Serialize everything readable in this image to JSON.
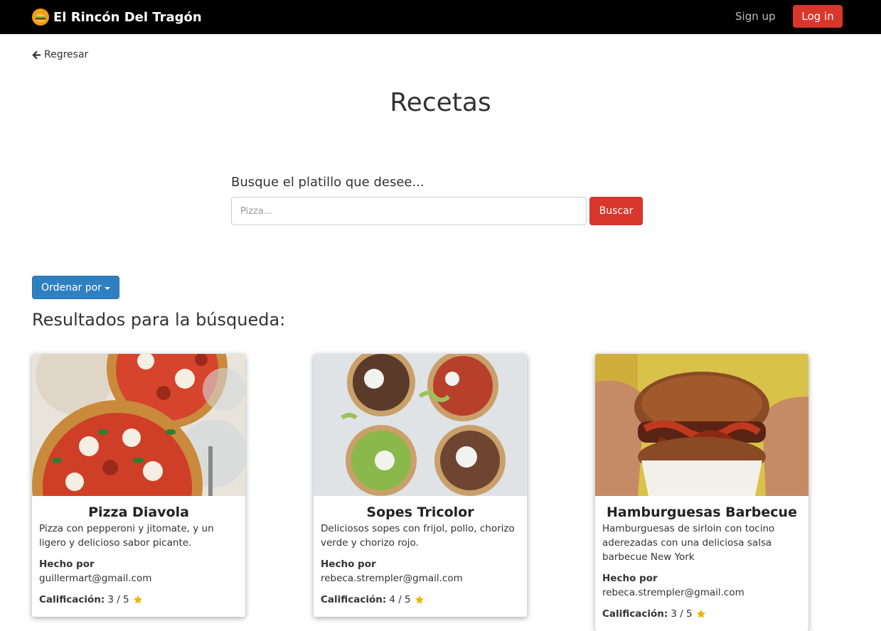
{
  "navbar": {
    "brand": "El Rincón Del Tragón",
    "signup": "Sign up",
    "login": "Log in"
  },
  "back_label": "Regresar",
  "page_title": "Recetas",
  "search": {
    "label": "Busque el platillo que desee...",
    "placeholder": "Pizza...",
    "button": "Buscar"
  },
  "sort_label": "Ordenar por",
  "results_title": "Resultados para la búsqueda:",
  "colors": {
    "accent": "#d9372b",
    "sort_button": "#2f80c1",
    "star": "#f0b400"
  },
  "recipes": [
    {
      "title": "Pizza Diavola",
      "description": "Pizza con pepperoni y jitomate, y un ligero y delicioso sabor picante.",
      "made_by_label": "Hecho por",
      "author": "guillermart@gmail.com",
      "rating_label": "Calificación:",
      "rating": "3 / 5"
    },
    {
      "title": "Sopes Tricolor",
      "description": "Deliciosos sopes con frijol, pollo, chorizo verde y chorizo rojo.",
      "made_by_label": "Hecho por",
      "author": "rebeca.strempler@gmail.com",
      "rating_label": "Calificación:",
      "rating": "4 / 5"
    },
    {
      "title": "Hamburguesas Barbecue",
      "description": "Hamburguesas de sirloin con tocino aderezadas con una deliciosa salsa barbecue New York",
      "made_by_label": "Hecho por",
      "author": "rebeca.strempler@gmail.com",
      "rating_label": "Calificación:",
      "rating": "3 / 5"
    }
  ]
}
